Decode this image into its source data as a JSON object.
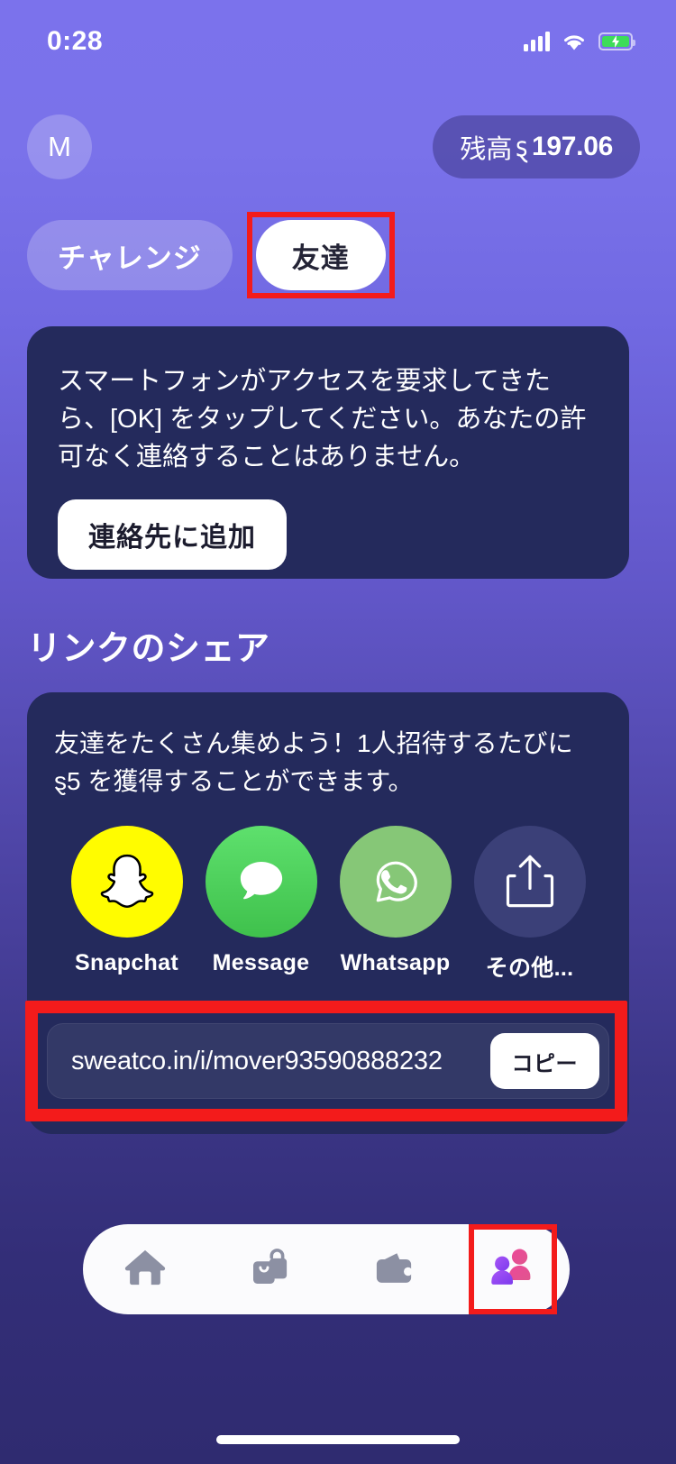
{
  "status_bar": {
    "time": "0:28",
    "signal_icon": "cellular-signal-icon",
    "wifi_icon": "wifi-icon",
    "battery_icon": "battery-charging-icon"
  },
  "header": {
    "avatar_initial": "M",
    "balance_label": "残高",
    "currency_symbol": "ȿ",
    "balance_amount": "197.06"
  },
  "tabs": [
    {
      "label": "チャレンジ",
      "active": false,
      "highlighted": false
    },
    {
      "label": "友達",
      "active": true,
      "highlighted": true
    }
  ],
  "contacts_card": {
    "body": "スマートフォンがアクセスを要求してきたら、[OK] をタップしてください。あなたの許可なく連絡することはありません。",
    "button_label": "連絡先に追加"
  },
  "share_section": {
    "title": "リンクのシェア",
    "body": "友達をたくさん集めよう！1人招待するたびに ȿ5 を獲得することができます。",
    "targets": [
      {
        "label": "Snapchat",
        "icon": "snapchat-ghost-icon",
        "color": "#FFFC00"
      },
      {
        "label": "Message",
        "icon": "message-bubble-icon",
        "color": "#4BD964"
      },
      {
        "label": "Whatsapp",
        "icon": "whatsapp-icon",
        "color": "#86C777"
      },
      {
        "label": "その他...",
        "icon": "share-export-icon",
        "color": "#3b4078"
      }
    ],
    "link_url": "sweatco.in/i/mover93590888232",
    "copy_label": "コピー"
  },
  "bottom_nav": [
    {
      "name": "home",
      "icon": "home-icon",
      "active": false
    },
    {
      "name": "shop",
      "icon": "shopping-bag-icon",
      "active": false
    },
    {
      "name": "wallet",
      "icon": "wallet-icon",
      "active": false
    },
    {
      "name": "friends",
      "icon": "friends-people-icon",
      "active": true
    }
  ],
  "annotations": {
    "highlight_color": "#f31b1b"
  }
}
